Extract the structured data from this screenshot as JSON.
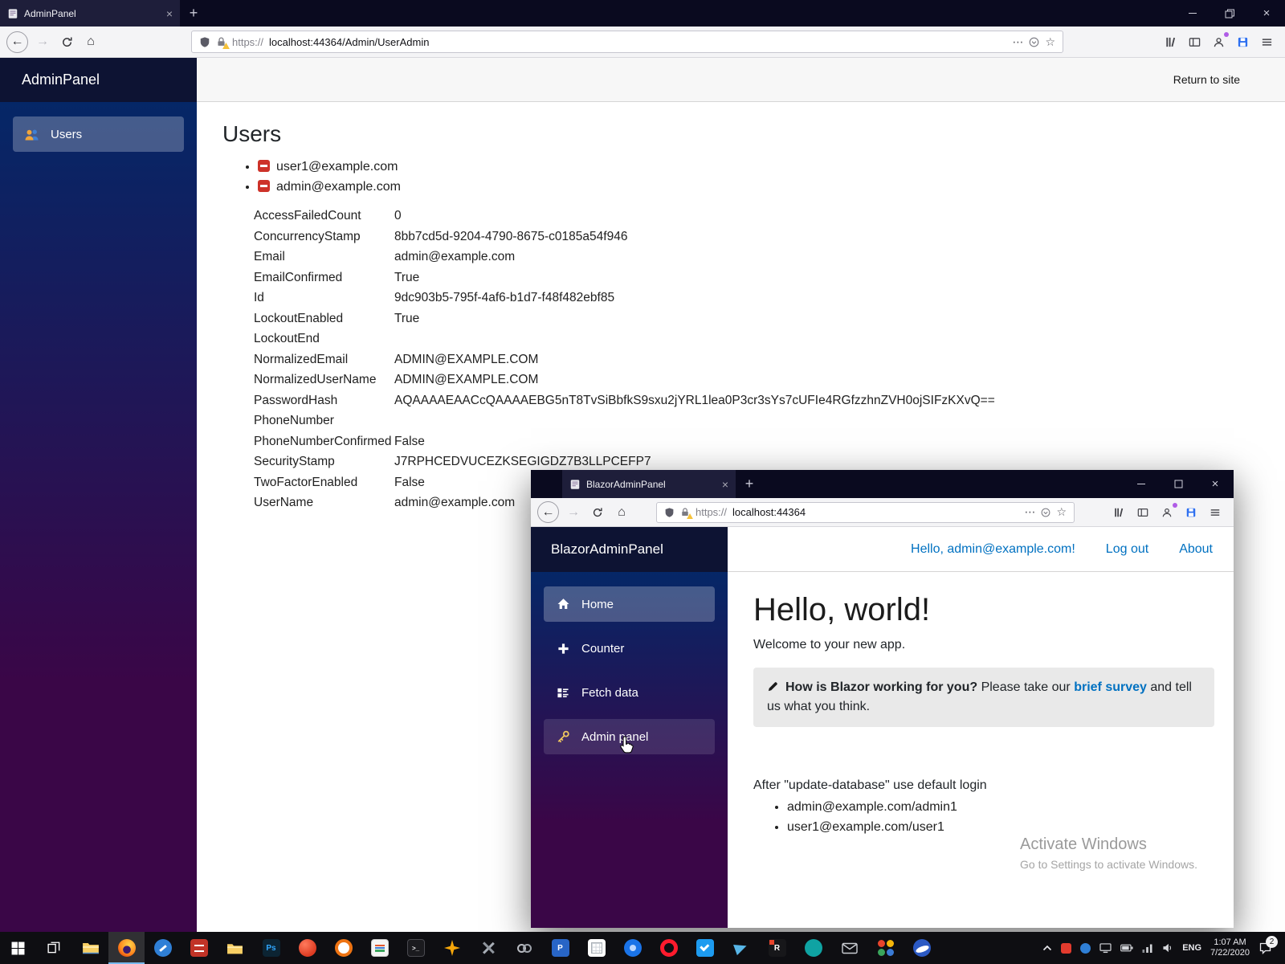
{
  "glyphs": {
    "back": "←",
    "forward": "→",
    "home": "⌂",
    "dots": "⋯",
    "star": "☆",
    "new_tab": "+",
    "close": "×",
    "tab_close": "×"
  },
  "main_window": {
    "tab_title": "AdminPanel",
    "url_protocol": "https://",
    "url_path": "localhost:44364/Admin/UserAdmin",
    "header": {
      "brand": "AdminPanel",
      "return_link": "Return to site"
    },
    "sidebar": {
      "items": [
        {
          "label": "Users"
        }
      ]
    },
    "content": {
      "title": "Users",
      "users": [
        {
          "email": "user1@example.com"
        },
        {
          "email": "admin@example.com"
        }
      ],
      "properties": [
        {
          "name": "AccessFailedCount",
          "value": "0"
        },
        {
          "name": "ConcurrencyStamp",
          "value": "8bb7cd5d-9204-4790-8675-c0185a54f946"
        },
        {
          "name": "Email",
          "value": "admin@example.com"
        },
        {
          "name": "EmailConfirmed",
          "value": "True"
        },
        {
          "name": "Id",
          "value": "9dc903b5-795f-4af6-b1d7-f48f482ebf85"
        },
        {
          "name": "LockoutEnabled",
          "value": "True"
        },
        {
          "name": "LockoutEnd",
          "value": ""
        },
        {
          "name": "NormalizedEmail",
          "value": "ADMIN@EXAMPLE.COM"
        },
        {
          "name": "NormalizedUserName",
          "value": "ADMIN@EXAMPLE.COM"
        },
        {
          "name": "PasswordHash",
          "value": "AQAAAAEAACcQAAAAEBG5nT8TvSiBbfkS9sxu2jYRL1lea0P3cr3sYs7cUFIe4RGfzzhnZVH0ojSIFzKXvQ=="
        },
        {
          "name": "PhoneNumber",
          "value": ""
        },
        {
          "name": "PhoneNumberConfirmed",
          "value": "False"
        },
        {
          "name": "SecurityStamp",
          "value": "J7RPHCEDVUCEZKSEGIGDZ7B3LLPCEFP7"
        },
        {
          "name": "TwoFactorEnabled",
          "value": "False"
        },
        {
          "name": "UserName",
          "value": "admin@example.com"
        }
      ]
    }
  },
  "blazor_window": {
    "tab_title": "BlazorAdminPanel",
    "url_protocol": "https://",
    "url_path": "localhost:44364",
    "header": {
      "brand": "BlazorAdminPanel",
      "greeting": "Hello, admin@example.com!",
      "logout": "Log out",
      "about": "About"
    },
    "sidebar": {
      "items": [
        {
          "label": "Home"
        },
        {
          "label": "Counter"
        },
        {
          "label": "Fetch data"
        },
        {
          "label": "Admin panel"
        }
      ]
    },
    "content": {
      "heading": "Hello, world!",
      "welcome": "Welcome to your new app.",
      "survey": {
        "bold": "How is Blazor working for you?",
        "middle": " Please take our ",
        "link": "brief survey",
        "end": " and tell us what you think."
      },
      "login_note": "After \"update-database\" use default login",
      "logins": [
        {
          "text": "admin@example.com/admin1"
        },
        {
          "text": "user1@example.com/user1"
        }
      ]
    },
    "watermark": {
      "line1": "Activate Windows",
      "line2": "Go to Settings to activate Windows."
    }
  },
  "taskbar": {
    "icon_glyphs": {
      "photoshop": "Ps",
      "terminal": ">_",
      "rider": "R",
      "letter_p": "P"
    },
    "tray": {
      "language": "ENG",
      "time": "1:07 AM",
      "date": "7/22/2020",
      "notification_badge": "2"
    }
  }
}
